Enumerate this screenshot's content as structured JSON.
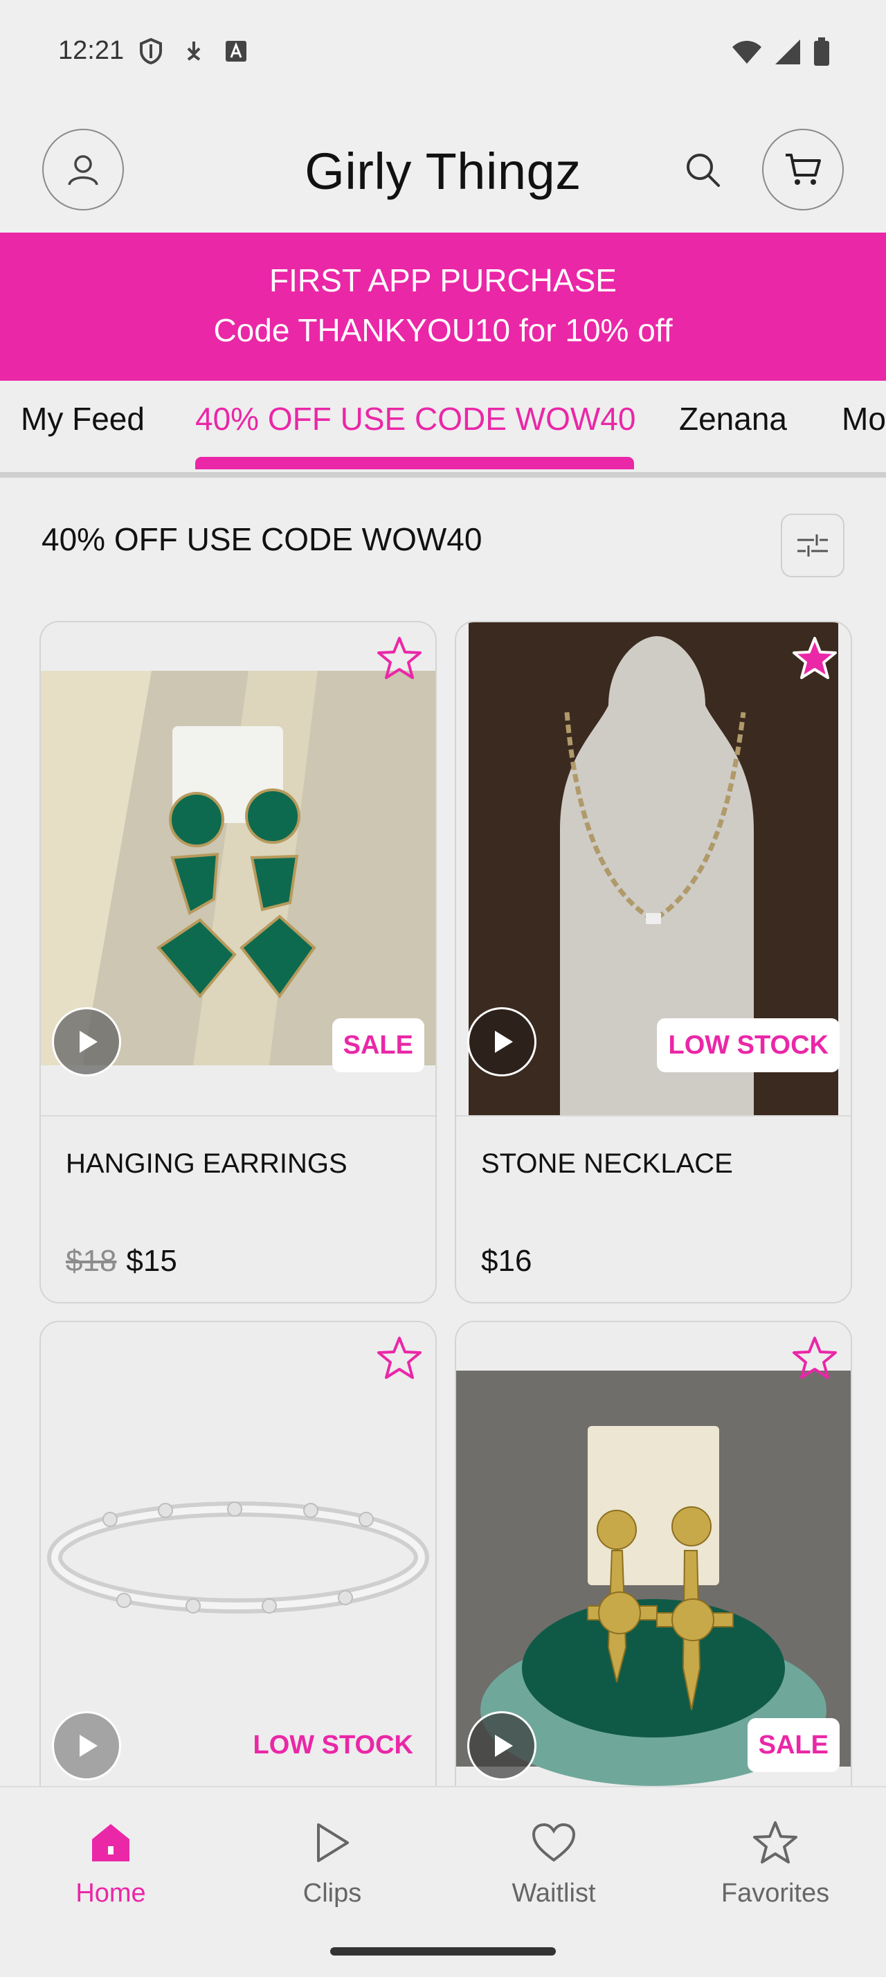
{
  "status_bar": {
    "time": "12:21"
  },
  "header": {
    "title": "Girly Thingz"
  },
  "promo": {
    "line1": "FIRST APP PURCHASE",
    "line2": "Code THANKYOU10 for 10% off"
  },
  "tabs": [
    {
      "label": "My Feed",
      "active": false
    },
    {
      "label": "40% OFF USE CODE WOW40",
      "active": true
    },
    {
      "label": "Zenana",
      "active": false
    },
    {
      "label": "Mo",
      "active": false
    }
  ],
  "section": {
    "title": "40% OFF USE CODE WOW40"
  },
  "products": [
    {
      "name": "HANGING EARRINGS",
      "old_price": "$18",
      "price": "$15",
      "badge": "SALE",
      "favorited": false
    },
    {
      "name": "STONE NECKLACE",
      "old_price": "",
      "price": "$16",
      "badge": "LOW STOCK",
      "favorited": true
    },
    {
      "name": "",
      "old_price": "",
      "price": "",
      "badge": "LOW STOCK",
      "favorited": false
    },
    {
      "name": "",
      "old_price": "",
      "price": "",
      "badge": "SALE",
      "favorited": false
    }
  ],
  "bottom_nav": [
    {
      "label": "Home",
      "icon": "home-icon",
      "active": true
    },
    {
      "label": "Clips",
      "icon": "play-outline-icon",
      "active": false
    },
    {
      "label": "Waitlist",
      "icon": "heart-icon",
      "active": false
    },
    {
      "label": "Favorites",
      "icon": "star-icon",
      "active": false
    }
  ],
  "colors": {
    "accent": "#ea27a7",
    "background": "#eeeeee"
  }
}
